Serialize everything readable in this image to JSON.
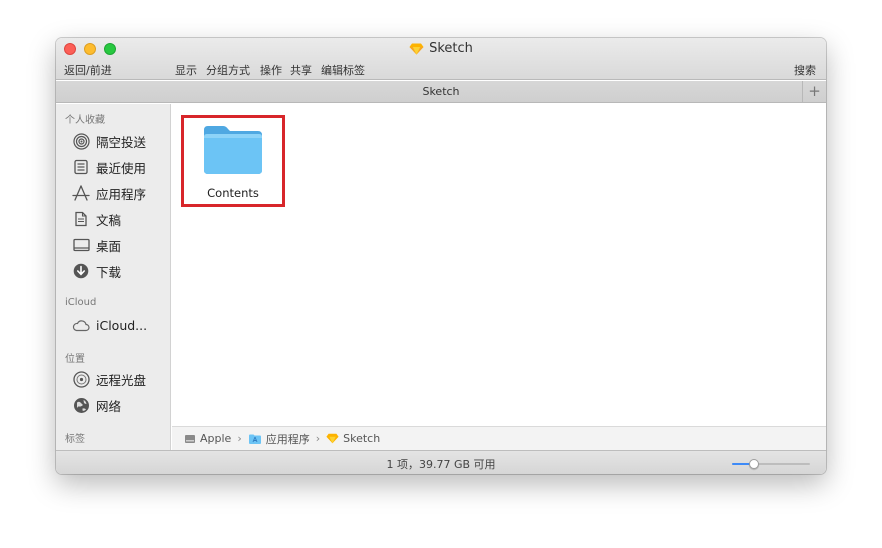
{
  "window": {
    "title": "Sketch",
    "app_icon": "sketch-diamond-icon"
  },
  "toolbar": {
    "back_forward": "返回/前进",
    "view": "显示",
    "group_by": "分组方式",
    "action": "操作",
    "share": "共享",
    "edit_tags": "编辑标签",
    "search": "搜索"
  },
  "tab": {
    "title": "Sketch",
    "add": "+"
  },
  "sidebar": {
    "favorites_header": "个人收藏",
    "favorites": [
      {
        "label": "隔空投送",
        "icon": "airdrop-icon"
      },
      {
        "label": "最近使用",
        "icon": "recents-icon"
      },
      {
        "label": "应用程序",
        "icon": "applications-icon"
      },
      {
        "label": "文稿",
        "icon": "documents-icon"
      },
      {
        "label": "桌面",
        "icon": "desktop-icon"
      },
      {
        "label": "下载",
        "icon": "downloads-icon"
      }
    ],
    "icloud_header": "iCloud",
    "icloud": [
      {
        "label": "iCloud...",
        "icon": "cloud-icon"
      }
    ],
    "locations_header": "位置",
    "locations": [
      {
        "label": "远程光盘",
        "icon": "remote-disc-icon"
      },
      {
        "label": "网络",
        "icon": "network-globe-icon"
      }
    ],
    "tags_header": "标签"
  },
  "content": {
    "items": [
      {
        "label": "Contents",
        "icon": "folder-icon",
        "highlighted": true
      }
    ],
    "highlight_color": "#d8262a"
  },
  "pathbar": {
    "segments": [
      {
        "label": "Apple",
        "icon": "hard-drive-icon"
      },
      {
        "label": "应用程序",
        "icon": "applications-folder-icon"
      },
      {
        "label": "Sketch",
        "icon": "sketch-diamond-icon"
      }
    ],
    "separator": "›"
  },
  "status": {
    "text": "1 项，39.77 GB 可用",
    "icon_size_fraction": 0.25
  },
  "colors": {
    "close": "#fc5f57",
    "minimize": "#fdbc2e",
    "maximize": "#28c840",
    "folder": "#5bb8f0",
    "accent": "#3d8af7"
  }
}
